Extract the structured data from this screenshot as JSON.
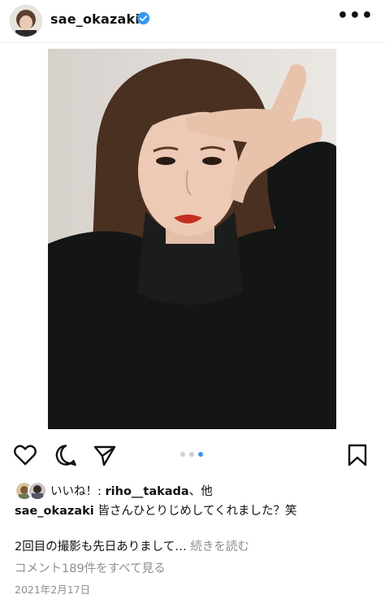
{
  "post": {
    "username": "sae_okazaki",
    "more_menu": "•••",
    "photo_description_icon": "portrait-photo",
    "carousel": {
      "count": 3,
      "active_index": 2
    },
    "likes": {
      "prefix": "いいね！: ",
      "user": "riho__takada",
      "suffix": "、他"
    },
    "caption": {
      "username": "sae_okazaki",
      "text": " 皆さんひとりじめしてくれました？笑"
    },
    "comment_preview": "2回目の撮影も先日ありまして…",
    "read_more": "続きを読む",
    "view_all_comments": "コメント189件をすべて見る",
    "date": "2021年2月17日"
  },
  "colors": {
    "verified": "#3897f0",
    "active_dot": "#3897f0",
    "muted_text": "#8e8e8e"
  },
  "icons": [
    "heart-icon",
    "comment-icon",
    "share-icon",
    "bookmark-icon",
    "verified-badge-icon",
    "more-icon"
  ]
}
